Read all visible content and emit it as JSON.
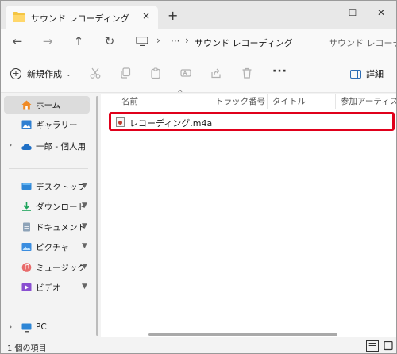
{
  "window": {
    "tab_title": "サウンド レコーディング",
    "tab_close": "×",
    "new_tab": "+",
    "minimize": "—",
    "maximize": "☐",
    "close": "✕"
  },
  "address": {
    "back": "←",
    "forward": "→",
    "up": "↑",
    "refresh": "↻",
    "sep1": "›",
    "ellipsis": "···",
    "sep2": "›",
    "path": "サウンド レコーディング",
    "search_placeholder": "サウンド レコーディング..."
  },
  "commands": {
    "new_label": "新規作成",
    "new_caret": "⌄",
    "more": "···",
    "details_label": "詳細"
  },
  "nav": {
    "quick": [
      {
        "label": "ホーム",
        "icon": "home-icon",
        "selected": true
      },
      {
        "label": "ギャラリー",
        "icon": "gallery-icon",
        "selected": false
      }
    ],
    "cloud": {
      "label": "一郎 - 個人用",
      "icon": "cloud-icon",
      "chevron": "›"
    },
    "pinned": [
      {
        "label": "デスクトップ",
        "icon": "desktop-icon",
        "pin": "📌"
      },
      {
        "label": "ダウンロード",
        "icon": "download-icon",
        "pin": "📌"
      },
      {
        "label": "ドキュメント",
        "icon": "documents-icon",
        "pin": "📌"
      },
      {
        "label": "ピクチャ",
        "icon": "pictures-icon",
        "pin": "📌"
      },
      {
        "label": "ミュージック",
        "icon": "music-icon",
        "pin": "📌"
      },
      {
        "label": "ビデオ",
        "icon": "videos-icon",
        "pin": "📌"
      }
    ],
    "pc": {
      "label": "PC",
      "icon": "pc-icon",
      "chevron": "›"
    }
  },
  "columns": {
    "name": "名前",
    "sort": "^",
    "track": "トラック番号",
    "title": "タイトル",
    "artist": "参加アーティスト"
  },
  "files": [
    {
      "name": "レコーディング.m4a",
      "icon": "audio-file-icon",
      "highlighted": true
    }
  ],
  "status": {
    "count": "1 個の項目"
  },
  "colors": {
    "highlight": "#e0001b",
    "accent": "#2d6db5",
    "folder": "#f4c542"
  }
}
